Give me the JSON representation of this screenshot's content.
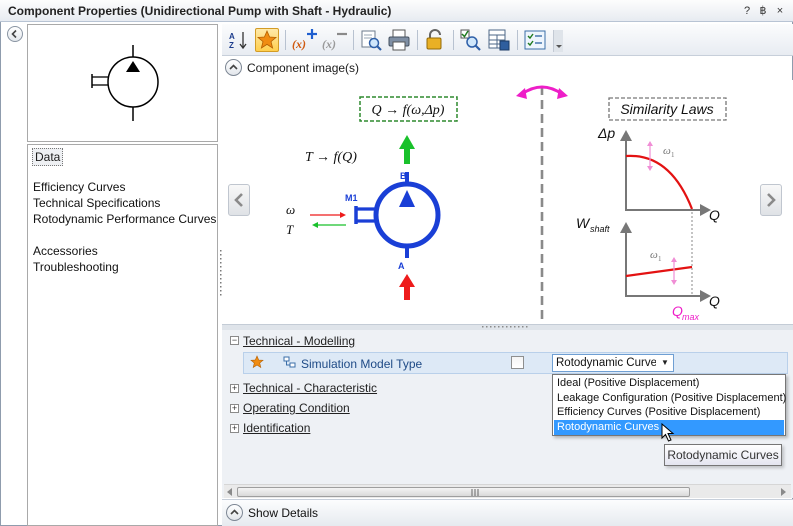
{
  "window": {
    "title": "Component Properties (Unidirectional Pump with Shaft - Hydraulic)",
    "controls": [
      "?",
      "฿",
      "×"
    ]
  },
  "nav": {
    "selected": "Data",
    "items": [
      "Efficiency Curves",
      "Technical Specifications",
      "Rotodynamic Performance Curves",
      "Accessories",
      "Troubleshooting"
    ]
  },
  "toolbar": {
    "buttons": [
      "sort-az-icon",
      "favorites-star-icon",
      "add-variable-icon",
      "remove-variable-icon",
      "preview-icon",
      "print-icon",
      "lock-icon",
      "check-search-icon",
      "calculator-grid-icon",
      "checklist-icon"
    ]
  },
  "image_section": {
    "label": "Component image(s)"
  },
  "pump_image": {
    "flow_box": "Q → f(ω,Δp)",
    "torque": "T → f(Q)",
    "port_b": "B",
    "port_a": "A",
    "port_m1": "M1",
    "omega": "ω",
    "t": "T"
  },
  "laws_image": {
    "title": "Similarity  Laws",
    "dp": "Δp",
    "q1": "Q",
    "omega1_top": "ω",
    "omega1_top_sub": "1",
    "wshaft": "W",
    "wshaft_sub": "shaft",
    "omega1_bottom": "ω",
    "omega1_bottom_sub": "1",
    "q2": "Q",
    "qmax": "Q",
    "qmax_sub": "max"
  },
  "properties": {
    "categories": [
      {
        "label": "Technical - Modelling",
        "expanded": true
      },
      {
        "label": "Technical - Characteristic",
        "expanded": false
      },
      {
        "label": "Operating Condition",
        "expanded": false
      },
      {
        "label": "Identification",
        "expanded": false
      }
    ],
    "row": {
      "name": "Simulation Model Type",
      "value": "Rotodynamic Curves",
      "options": [
        "Ideal (Positive Displacement)",
        "Leakage Configuration (Positive Displacement)",
        "Efficiency Curves (Positive Displacement)",
        "Rotodynamic Curves"
      ],
      "selected_index": 3
    }
  },
  "tooltip": "Rotodynamic Curves",
  "footer": {
    "show_details": "Show Details"
  },
  "colors": {
    "pump_blue": "#1a3fd6",
    "flow_green": "#19c12b",
    "flow_red": "#ee1b1b",
    "magenta": "#ee1ec8",
    "curve_red": "#e31212",
    "selection_blue": "#3399ff"
  }
}
